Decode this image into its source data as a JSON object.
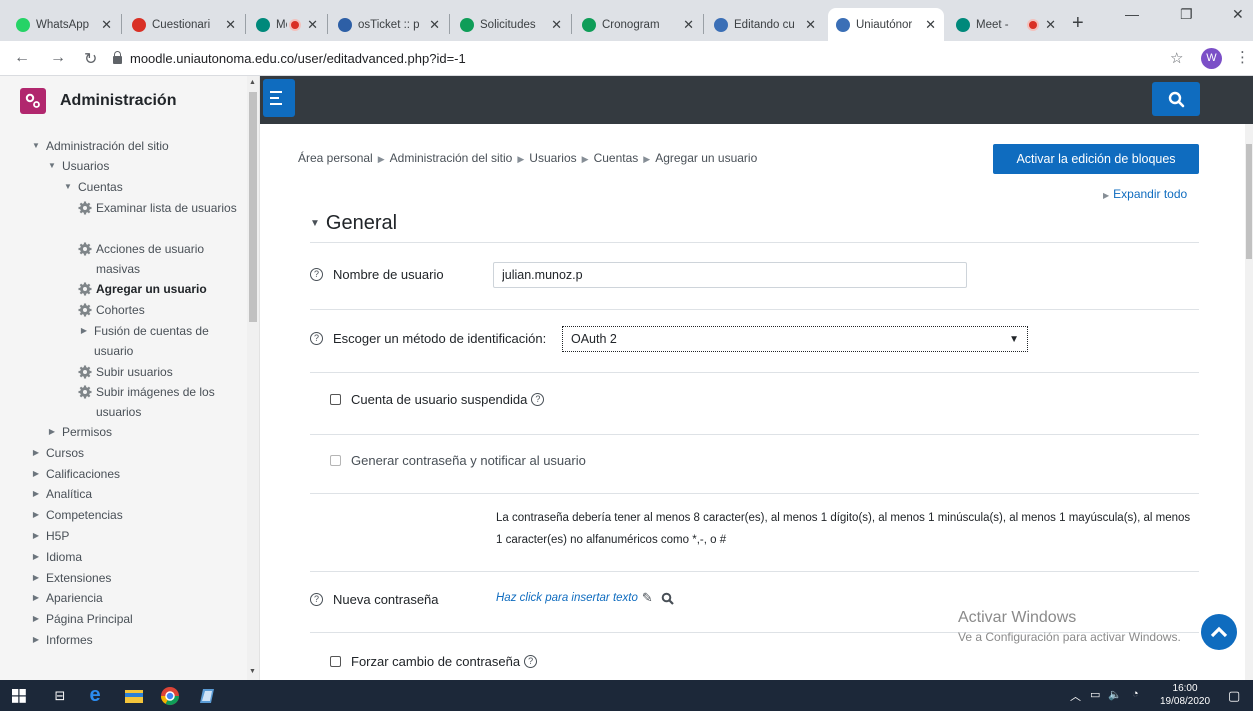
{
  "browser": {
    "tabs": [
      {
        "title": "WhatsApp",
        "icon": "whatsapp-icon",
        "color": "#25d366"
      },
      {
        "title": "Cuestionari",
        "icon": "gmail-icon",
        "color": "#d93025"
      },
      {
        "title": "Meet -",
        "icon": "meet-icon",
        "color": "#00897b"
      },
      {
        "title": "osTicket :: p",
        "icon": "osticket-icon",
        "color": "#2d5fa6"
      },
      {
        "title": "Solicitudes",
        "icon": "sheets-icon",
        "color": "#0f9d58"
      },
      {
        "title": "Cronogram",
        "icon": "sheets-icon",
        "color": "#0f9d58"
      },
      {
        "title": "Editando cu",
        "icon": "moodle-icon",
        "color": "#3b6fb6"
      },
      {
        "title": "Uniautónor",
        "icon": "moodle-icon",
        "color": "#3b6fb6"
      },
      {
        "title": "Meet -",
        "icon": "meet-icon",
        "color": "#00897b"
      }
    ],
    "url": "moodle.uniautonoma.edu.co/user/editadvanced.php?id=-1",
    "profile_initial": "W"
  },
  "sidebar": {
    "title": "Administración",
    "items": [
      {
        "label": "Administración del sitio",
        "level": 0,
        "toggle": "open"
      },
      {
        "label": "Usuarios",
        "level": 1,
        "toggle": "open"
      },
      {
        "label": "Cuentas",
        "level": 2,
        "toggle": "open"
      },
      {
        "label": "Examinar lista de usuarios",
        "level": 3,
        "toggle": "gear"
      },
      {
        "label": "Acciones de usuario masivas",
        "level": 3,
        "toggle": "gear"
      },
      {
        "label": "Agregar un usuario",
        "level": 3,
        "toggle": "gear",
        "active": true
      },
      {
        "label": "Cohortes",
        "level": 3,
        "toggle": "gear"
      },
      {
        "label": "Fusión de cuentas de usuario",
        "level": 3,
        "toggle": "closed"
      },
      {
        "label": "Subir usuarios",
        "level": 3,
        "toggle": "gear"
      },
      {
        "label": "Subir imágenes de los usuarios",
        "level": 3,
        "toggle": "gear"
      },
      {
        "label": "Permisos",
        "level": 1,
        "toggle": "closed"
      },
      {
        "label": "Cursos",
        "level": 0,
        "toggle": "closed"
      },
      {
        "label": "Calificaciones",
        "level": 0,
        "toggle": "closed"
      },
      {
        "label": "Analítica",
        "level": 0,
        "toggle": "closed"
      },
      {
        "label": "Competencias",
        "level": 0,
        "toggle": "closed"
      },
      {
        "label": "H5P",
        "level": 0,
        "toggle": "closed"
      },
      {
        "label": "Idioma",
        "level": 0,
        "toggle": "closed"
      },
      {
        "label": "Extensiones",
        "level": 0,
        "toggle": "closed"
      },
      {
        "label": "Apariencia",
        "level": 0,
        "toggle": "closed"
      },
      {
        "label": "Página Principal",
        "level": 0,
        "toggle": "closed"
      },
      {
        "label": "Informes",
        "level": 0,
        "toggle": "closed"
      }
    ]
  },
  "breadcrumb": [
    "Área personal",
    "Administración del sitio",
    "Usuarios",
    "Cuentas",
    "Agregar un usuario"
  ],
  "edit_blocks_button": "Activar la edición de bloques",
  "expand_all": "Expandir todo",
  "section_title": "General",
  "form": {
    "username_label": "Nombre de usuario",
    "username_value": "julian.munoz.p",
    "auth_label": "Escoger un método de identificación:",
    "auth_value": "OAuth 2",
    "suspended_label": "Cuenta de usuario suspendida",
    "generate_password_label": "Generar contraseña y notificar al usuario",
    "password_policy": "La contraseña debería tener al menos 8 caracter(es), al menos 1 dígito(s), al menos 1 minúscula(s), al menos 1 mayúscula(s), al menos 1 caracter(es) no alfanuméricos como *,-, o #",
    "new_password_label": "Nueva contraseña",
    "new_password_placeholder": "Haz click para insertar texto",
    "force_change_label": "Forzar cambio de contraseña"
  },
  "watermark": {
    "line1": "Activar Windows",
    "line2": "Ve a Configuración para activar Windows."
  },
  "taskbar": {
    "time": "16:00",
    "date": "19/08/2020"
  },
  "colors": {
    "accent": "#0f6cbf",
    "navbar": "#343a40",
    "admin_icon": "#b1276e"
  }
}
